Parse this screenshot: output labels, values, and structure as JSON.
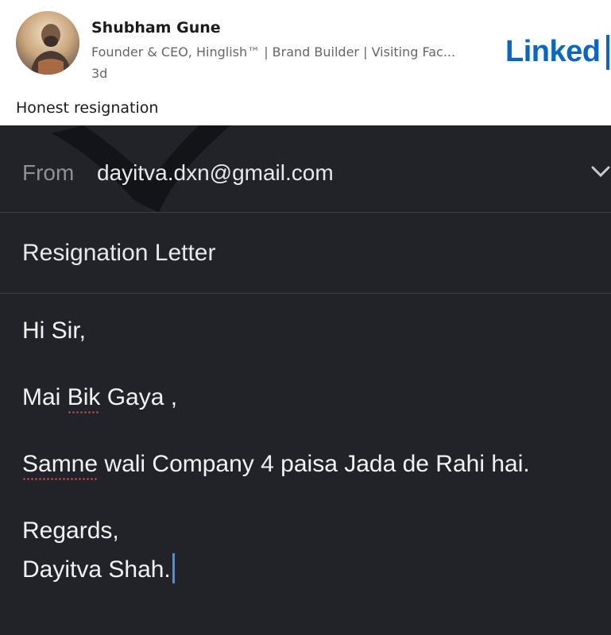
{
  "post": {
    "author_name": "Shubham Gune",
    "author_headline": "Founder & CEO, Hinglish™ | Brand Builder | Visiting Fac...",
    "age": "3d",
    "text": "Honest resignation",
    "brand": "Linked"
  },
  "email": {
    "from_label": "From",
    "from_value": "dayitva.dxn@gmail.com",
    "subject": "Resignation Letter",
    "greeting": "Hi Sir,",
    "line2_pre": "Mai ",
    "line2_spell": "Bik",
    "line2_post": " Gaya ,",
    "line3_spell": "Samne",
    "line3_post": " wali Company 4 paisa Jada de Rahi hai.",
    "regards": "Regards,",
    "signature": "Dayitva Shah."
  },
  "colors": {
    "linkedin_blue": "#0a66c2",
    "email_bg": "#212329",
    "caret": "#4a8fe7",
    "spellcheck": "#d9534f"
  },
  "icons": [
    "avatar-photo",
    "chevron-down-icon"
  ]
}
